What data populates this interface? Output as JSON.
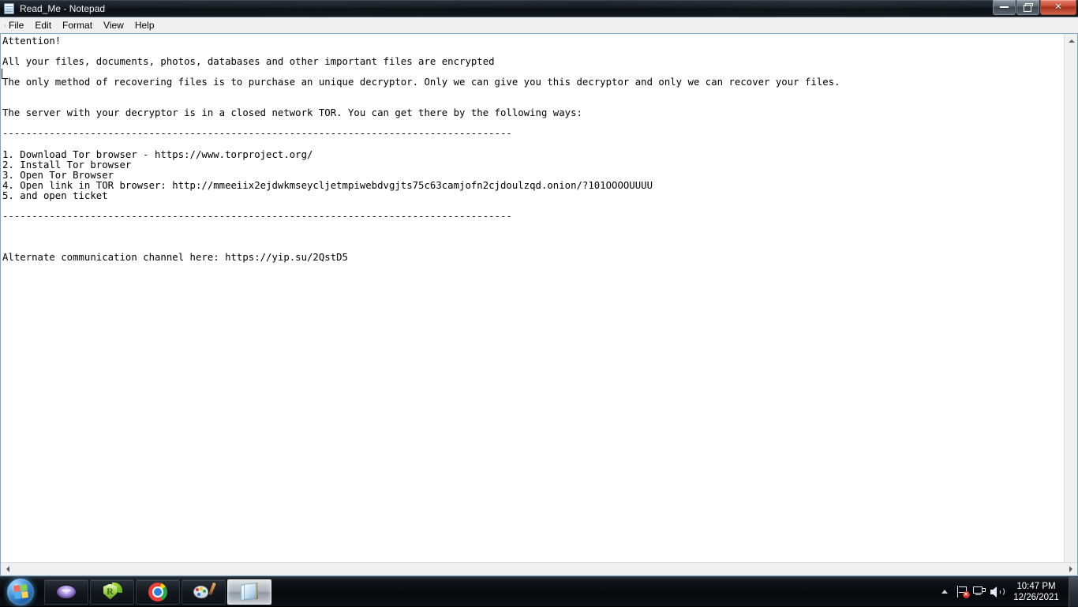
{
  "window": {
    "title": "Read_Me - Notepad",
    "icon": "notepad-icon",
    "controls": {
      "minimize": "Minimize",
      "restore": "Restore Down",
      "close": "Close"
    }
  },
  "menu": {
    "items": [
      {
        "label": "File"
      },
      {
        "label": "Edit"
      },
      {
        "label": "Format"
      },
      {
        "label": "View"
      },
      {
        "label": "Help"
      }
    ]
  },
  "document": {
    "content": "Attention!\n\nAll your files, documents, photos, databases and other important files are encrypted\n\nThe only method of recovering files is to purchase an unique decryptor. Only we can give you this decryptor and only we can recover your files.\n\n\nThe server with your decryptor is in a closed network TOR. You can get there by the following ways:\n\n---------------------------------------------------------------------------------------\n\n1. Download Tor browser - https://www.torproject.org/\n2. Install Tor browser\n3. Open Tor Browser\n4. Open link in TOR browser: http://mmeeiix2ejdwkmseycljetmpiwebdvgjts75c63camjofn2cjdoulzqd.onion/?101OOOOUUUU\n5. and open ticket\n\n---------------------------------------------------------------------------------------\n\n\n\nAlternate communication channel here: https://yip.su/2QstD5",
    "lines": [
      "Attention!",
      "",
      "All your files, documents, photos, databases and other important files are encrypted",
      "",
      "The only method of recovering files is to purchase an unique decryptor. Only we can give you this decryptor and only we can recover your files.",
      "",
      "",
      "The server with your decryptor is in a closed network TOR. You can get there by the following ways:",
      "",
      "---------------------------------------------------------------------------------------",
      "",
      "1. Download Tor browser - https://www.torproject.org/",
      "2. Install Tor browser",
      "3. Open Tor Browser",
      "4. Open link in TOR browser: http://mmeeiix2ejdwkmseycljetmpiwebdvgjts75c63camjofn2cjdoulzqd.onion/?101OOOOUUUU",
      "5. and open ticket",
      "",
      "---------------------------------------------------------------------------------------",
      "",
      "",
      "",
      "Alternate communication channel here: https://yip.su/2QstD5"
    ],
    "tor_browser_url": "https://www.torproject.org/",
    "onion_url": "http://mmeeiix2ejdwkmseycljetmpiwebdvgjts75c63camjofn2cjdoulzqd.onion/?101OOOOUUUU",
    "alternate_channel_url": "https://yip.su/2QstD5"
  },
  "scrollbars": {
    "vertical_up": "▲",
    "vertical_down": "▼",
    "horizontal_left": "◀",
    "horizontal_right": "▶"
  },
  "taskbar": {
    "start": "Start",
    "buttons": [
      {
        "name": "taskbar-app-oval",
        "label": ""
      },
      {
        "name": "taskbar-app-shield",
        "label": "R"
      },
      {
        "name": "taskbar-app-chrome",
        "label": ""
      },
      {
        "name": "taskbar-app-paint",
        "label": ""
      },
      {
        "name": "taskbar-app-notepad",
        "label": "",
        "active": true
      }
    ],
    "tray": {
      "expand": "Show hidden icons",
      "action_center_badge": "✕",
      "icons": [
        "action-center-icon",
        "network-icon",
        "volume-icon"
      ]
    },
    "clock": {
      "time": "10:47 PM",
      "date": "12/26/2021"
    }
  },
  "colors": {
    "accent_close": "#c54b33",
    "window_text_bg": "#ffffff",
    "menu_bg": "#f0f0f0",
    "taskbar_bg": "#05070a",
    "window_border": "#7ba7c8"
  }
}
